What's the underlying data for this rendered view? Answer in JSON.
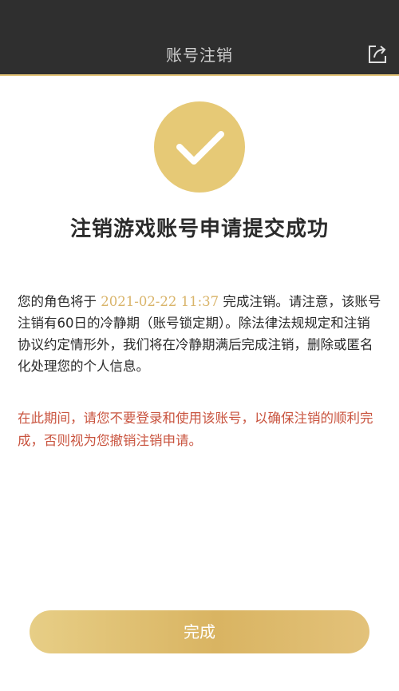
{
  "header": {
    "title": "账号注销",
    "share_icon": "share-export-icon"
  },
  "result": {
    "icon": "checkmark-icon",
    "title": "注销游戏账号申请提交成功"
  },
  "notice": {
    "prefix": "您的角色将于 ",
    "date": "2021-02-22 11:37",
    "suffix": " 完成注销。请注意，该账号注销有60日的冷静期（账号锁定期）。除法律法规规定和注销协议约定情形外，我们将在冷静期满后完成注销，删除或匿名化处理您的个人信息。"
  },
  "warning": {
    "text": "在此期间，请您不要登录和使用该账号，以确保注销的顺利完成，否则视为您撤销注销申请。"
  },
  "actions": {
    "done_label": "完成"
  },
  "colors": {
    "header_bg": "#2f2f2f",
    "accent_gold": "#e6c976",
    "warning_red": "#c9543f"
  }
}
